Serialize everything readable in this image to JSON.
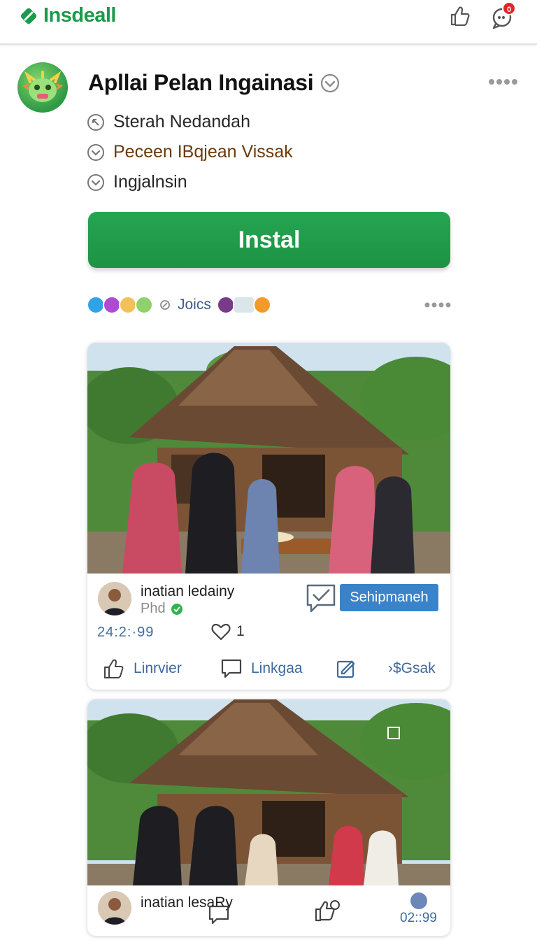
{
  "header": {
    "brand": "Insdeall",
    "notification_count": "0",
    "icons": [
      "tag-icon",
      "thumbs-up-icon",
      "chat-bubble-icon"
    ]
  },
  "app": {
    "title": "Apllai Pelan Ingainasi",
    "meta": [
      {
        "icon": "location-icon",
        "text": "Sterah Nedandah"
      },
      {
        "icon": "chevron-icon",
        "text": "Peceen IBqjean Vissak"
      },
      {
        "icon": "chevron-icon",
        "text": "Ingjalnsin"
      }
    ],
    "install_label": "Instal"
  },
  "reactions": {
    "label": "Joics",
    "colors": [
      "#2fa3e6",
      "#b14ad3",
      "#f2c15a",
      "#8fd16a",
      "#7a3a8a",
      "#f39a2b"
    ]
  },
  "colors": {
    "brand": "#1b9a4c",
    "install": "#1e9a48",
    "action": "#3a83c9",
    "link": "#3e6a9e"
  },
  "posts": [
    {
      "author": "inatian ledainy",
      "subtitle": "Phd",
      "action_label": "Sehipmaneh",
      "time": "24:2:·99",
      "likes": "1",
      "actions": [
        {
          "icon": "thumbs-up-icon",
          "label": "Linrvier"
        },
        {
          "icon": "comment-icon",
          "label": "Linkgaa"
        },
        {
          "icon": "edit-icon",
          "label": ""
        },
        {
          "icon": "share-icon",
          "label": "›$Gsak"
        }
      ]
    },
    {
      "author": "inatian lesaRy",
      "time": "02::99"
    }
  ]
}
